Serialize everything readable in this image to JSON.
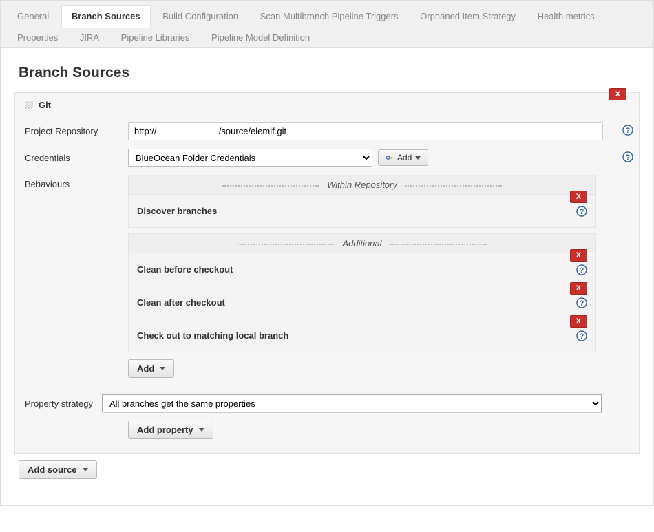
{
  "tabs_row1": [
    "General",
    "Branch Sources",
    "Build Configuration",
    "Scan Multibranch Pipeline Triggers",
    "Orphaned Item Strategy",
    "Health metrics"
  ],
  "tabs_row2": [
    "Properties",
    "JIRA",
    "Pipeline Libraries",
    "Pipeline Model Definition"
  ],
  "active_tab": "Branch Sources",
  "section_title": "Branch Sources",
  "source": {
    "type": "Git",
    "delete_label": "X",
    "repo": {
      "label": "Project Repository",
      "value": "http://                         /source/elemif.git"
    },
    "credentials": {
      "label": "Credentials",
      "selected": "BlueOcean Folder Credentials",
      "add_button": "Add"
    },
    "behaviours": {
      "label": "Behaviours",
      "within_header": "Within Repository",
      "additional_header": "Additional",
      "within_items": [
        "Discover branches"
      ],
      "additional_items": [
        "Clean before checkout",
        "Clean after checkout",
        "Check out to matching local branch"
      ],
      "add_button": "Add"
    },
    "property_strategy": {
      "label": "Property strategy",
      "selected": "All branches get the same properties",
      "add_property_button": "Add property"
    }
  },
  "add_source_button": "Add source"
}
